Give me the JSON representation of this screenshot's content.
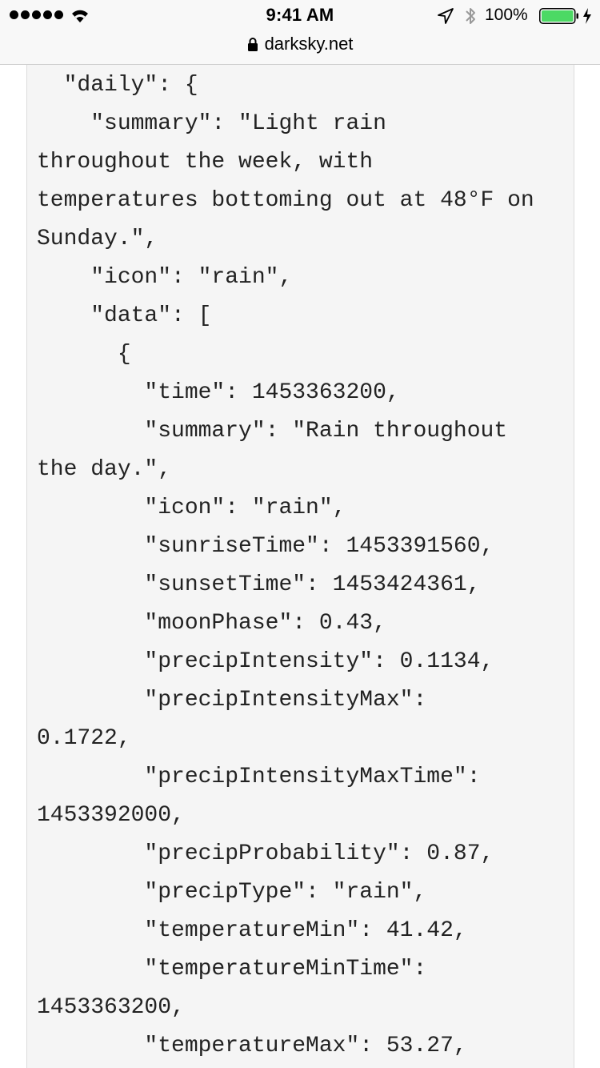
{
  "status_bar": {
    "time": "9:41 AM",
    "battery_percent": "100%",
    "battery_level": 1.0,
    "signal_dots": 5,
    "icons": [
      "signal-dots-icon",
      "wifi-icon",
      "location-arrow-icon",
      "bluetooth-icon",
      "battery-icon",
      "charging-bolt-icon"
    ]
  },
  "url_bar": {
    "domain": "darksky.net",
    "icon": "lock-icon"
  },
  "code": {
    "lines": [
      "  \"daily\": {",
      "    \"summary\": \"Light rain",
      "throughout the week, with",
      "temperatures bottoming out at 48°F on",
      "Sunday.\",",
      "    \"icon\": \"rain\",",
      "    \"data\": [",
      "      {",
      "        \"time\": 1453363200,",
      "        \"summary\": \"Rain throughout",
      "the day.\",",
      "        \"icon\": \"rain\",",
      "        \"sunriseTime\": 1453391560,",
      "        \"sunsetTime\": 1453424361,",
      "        \"moonPhase\": 0.43,",
      "        \"precipIntensity\": 0.1134,",
      "        \"precipIntensityMax\":",
      "0.1722,",
      "        \"precipIntensityMaxTime\":",
      "1453392000,",
      "        \"precipProbability\": 0.87,",
      "        \"precipType\": \"rain\",",
      "        \"temperatureMin\": 41.42,",
      "        \"temperatureMinTime\":",
      "1453363200,",
      "        \"temperatureMax\": 53.27,"
    ]
  },
  "colors": {
    "chrome_background": "#f8f8f8",
    "code_background": "#f5f5f5",
    "battery_green": "#4cd964",
    "text": "#222222"
  }
}
